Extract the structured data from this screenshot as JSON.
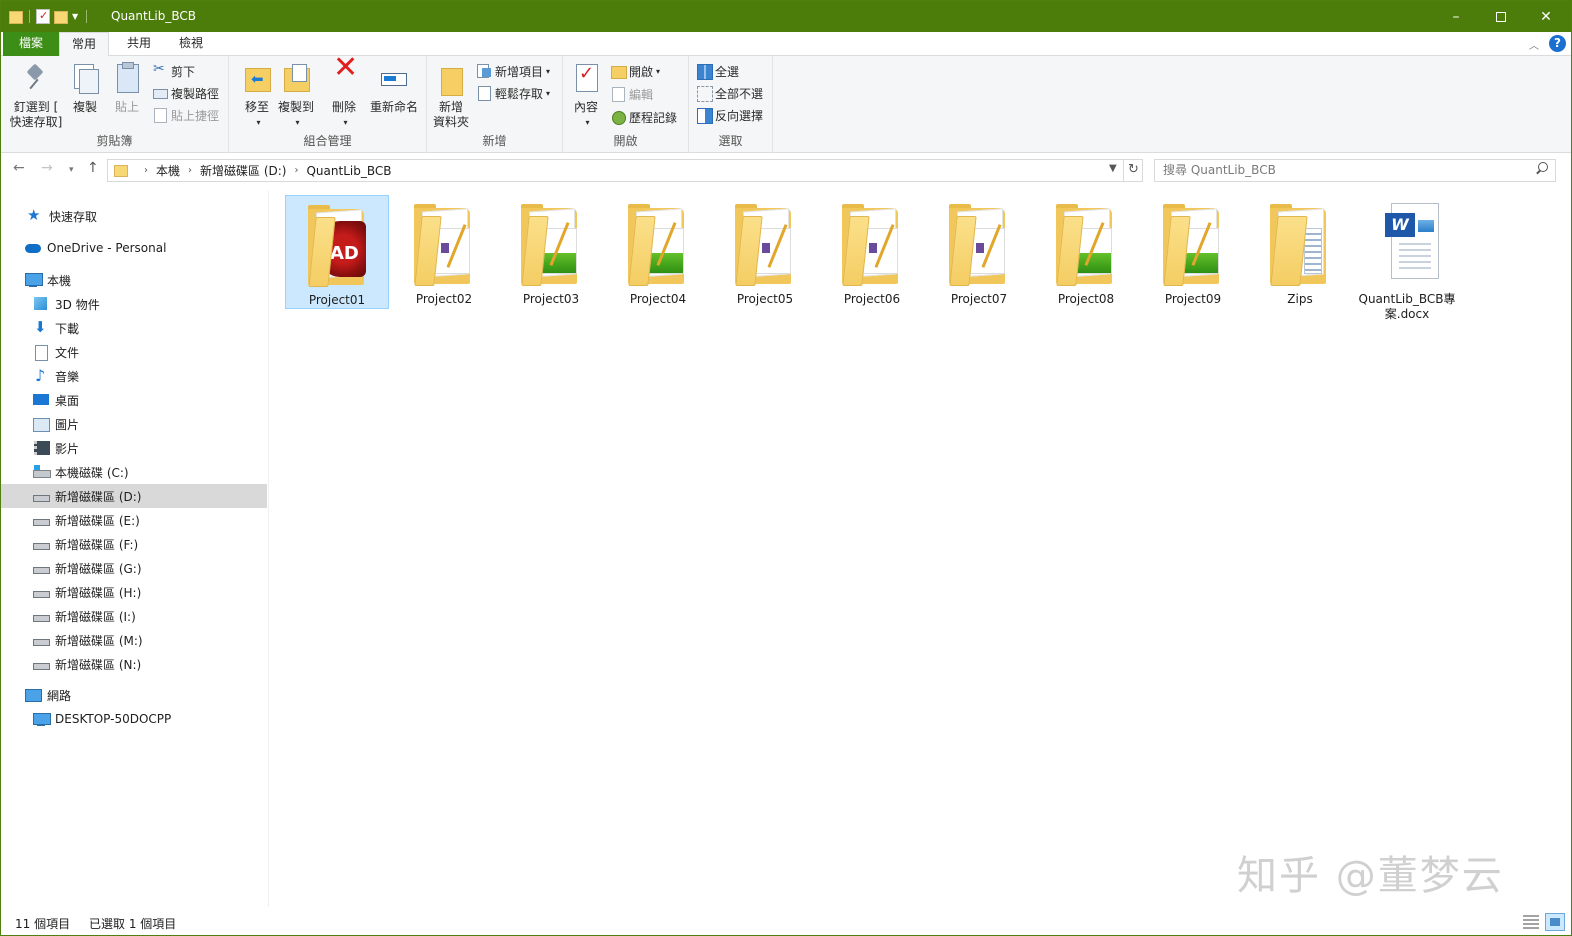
{
  "window": {
    "title": "QuantLib_BCB",
    "minimize": "–",
    "close": "✕"
  },
  "ribbon_tabs": {
    "file": "檔案",
    "home": "常用",
    "share": "共用",
    "view": "檢視",
    "help": "?"
  },
  "ribbon": {
    "clipboard": {
      "label": "剪貼簿",
      "pin_line1": "釘選到 [",
      "pin_line2": "快速存取]",
      "copy": "複製",
      "paste": "貼上",
      "cut": "剪下",
      "copy_path": "複製路徑",
      "paste_shortcut": "貼上捷徑"
    },
    "organize": {
      "label": "組合管理",
      "move_to": "移至",
      "copy_to": "複製到",
      "delete": "刪除",
      "rename": "重新命名"
    },
    "new": {
      "label": "新增",
      "new_folder_line1": "新增",
      "new_folder_line2": "資料夾",
      "new_item": "新增項目",
      "easy_access": "輕鬆存取"
    },
    "open": {
      "label": "開啟",
      "properties": "內容",
      "open": "開啟",
      "edit": "編輯",
      "history": "歷程記錄"
    },
    "select": {
      "label": "選取",
      "select_all": "全選",
      "select_none": "全部不選",
      "invert": "反向選擇"
    }
  },
  "address": {
    "crumbs": [
      "本機",
      "新增磁碟區 (D:)",
      "QuantLib_BCB"
    ],
    "search_placeholder": "搜尋 QuantLib_BCB"
  },
  "nav": {
    "quick_access": "快速存取",
    "onedrive": "OneDrive - Personal",
    "this_pc": "本機",
    "items": [
      "3D 物件",
      "下載",
      "文件",
      "音樂",
      "桌面",
      "圖片",
      "影片",
      "本機磁碟 (C:)",
      "新增磁碟區 (D:)",
      "新增磁碟區 (E:)",
      "新增磁碟區 (F:)",
      "新增磁碟區 (G:)",
      "新增磁碟區 (H:)",
      "新增磁碟區 (I:)",
      "新增磁碟區 (M:)",
      "新增磁碟區 (N:)"
    ],
    "network": "網路",
    "computer": "DESKTOP-50DOCPP"
  },
  "files": [
    {
      "name": "Project01"
    },
    {
      "name": "Project02"
    },
    {
      "name": "Project03"
    },
    {
      "name": "Project04"
    },
    {
      "name": "Project05"
    },
    {
      "name": "Project06"
    },
    {
      "name": "Project07"
    },
    {
      "name": "Project08"
    },
    {
      "name": "Project09"
    },
    {
      "name": "Zips"
    },
    {
      "name": "QuantLib_BCB專案.docx"
    }
  ],
  "status": {
    "count": "11 個項目",
    "selected": "已選取 1 個項目"
  },
  "watermark": "知乎 @董梦云",
  "colors": {
    "titlebar": "#4c7d0b",
    "file_tab": "#3c8e16",
    "selection": "#cce8ff"
  }
}
